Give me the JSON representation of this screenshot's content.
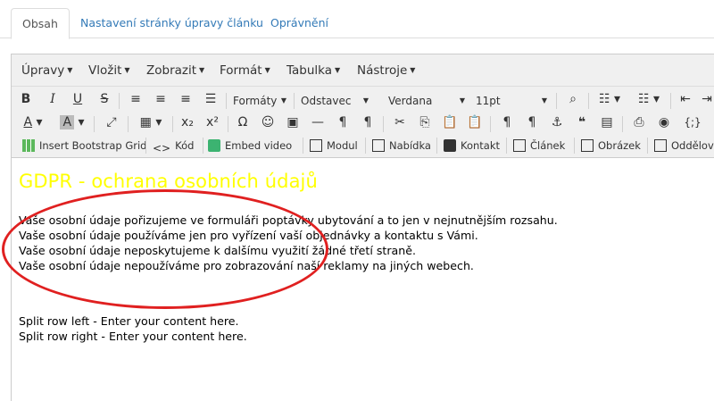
{
  "tabs": [
    {
      "label": "Obsah"
    },
    {
      "label": "Nastavení stránky úpravy článku"
    },
    {
      "label": "Oprávnění"
    }
  ],
  "menubar": [
    {
      "label": "Úpravy"
    },
    {
      "label": "Vložit"
    },
    {
      "label": "Zobrazit"
    },
    {
      "label": "Formát"
    },
    {
      "label": "Tabulka"
    },
    {
      "label": "Nástroje"
    }
  ],
  "toolbar": {
    "formats_label": "Formáty",
    "block_format": "Odstavec",
    "font_family": "Verdana",
    "font_size": "11pt",
    "plugins": [
      {
        "label": "Insert Bootstrap Grid",
        "icon": "grid-icon"
      },
      {
        "label": "Kód",
        "icon": "code-icon"
      },
      {
        "label": "Embed video",
        "icon": "video-icon"
      },
      {
        "label": "Modul",
        "icon": "module-icon"
      },
      {
        "label": "Nabídka",
        "icon": "menu-link-icon"
      },
      {
        "label": "Kontakt",
        "icon": "contact-icon"
      },
      {
        "label": "Článek",
        "icon": "article-icon"
      },
      {
        "label": "Obrázek",
        "icon": "image-icon"
      },
      {
        "label": "Oddělovač",
        "icon": "pagebreak-icon"
      }
    ]
  },
  "content": {
    "heading": "GDPR - ochrana osobních údajů",
    "paragraphs": [
      "Vaše osobní údaje pořizujeme ve formuláři poptávky ubytování a to jen v nejnutnějším rozsahu.",
      "Vaše osobní údaje používáme jen pro vyřízení vaší objednávky a kontaktu s Vámi.",
      "Vaše osobní údaje neposkytujeme k dalšímu využití žádné třetí straně.",
      "Vaše osobní údaje nepoužíváme pro zobrazování naší reklamy na jiných webech."
    ],
    "split_left": "Split row left - Enter your content here.",
    "split_right": "Split row right - Enter your content here."
  },
  "colors": {
    "heading": "#ffff00",
    "annotation_circle": "#e02020",
    "link": "#337ab7"
  }
}
